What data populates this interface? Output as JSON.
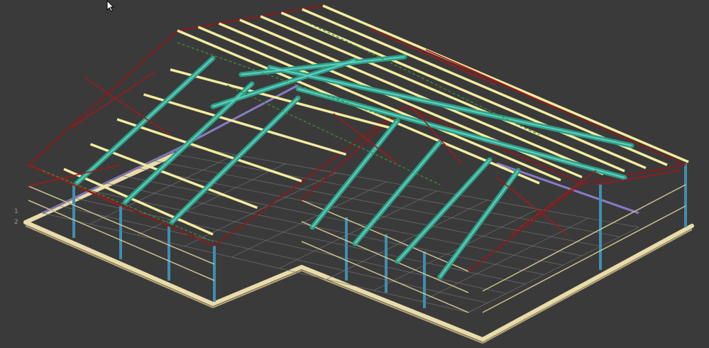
{
  "viewport": {
    "background": "#3a3a3a",
    "cursor_icon": "arrow-cursor-icon"
  },
  "model": {
    "description_colors": {
      "rafter": "#2e9e88",
      "rafter_light": "#5fd1bf",
      "purlin": "#f2eca0",
      "bracing_red": "#a01a1a",
      "bracing_green": "#3b8f3b",
      "column": "#3f8fb0",
      "grid": "#6f6f6f",
      "foundation": "#e8dcaa",
      "blue_beam": "#8a7ac8"
    },
    "axis_marks": [
      "1",
      "2"
    ]
  }
}
